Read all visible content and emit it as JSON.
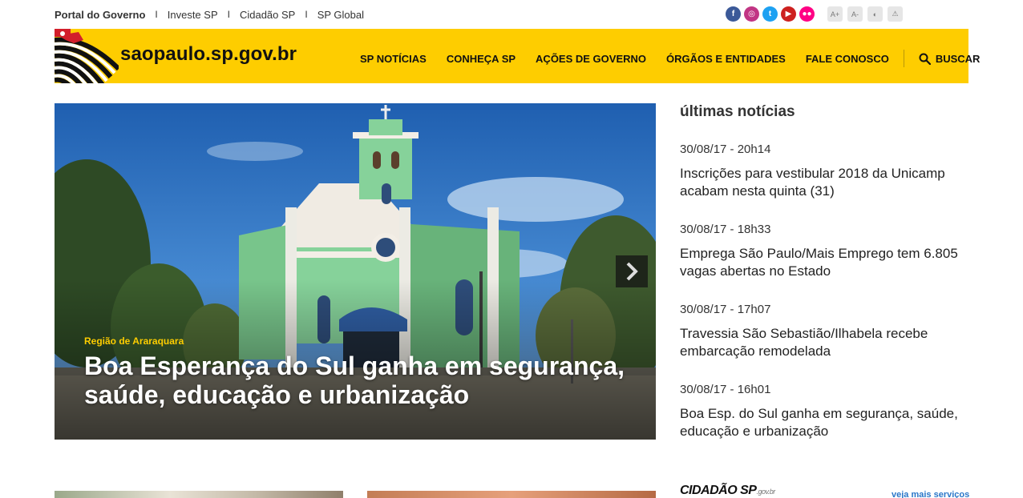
{
  "top_links": [
    "Portal do Governo",
    "Investe SP",
    "Cidadão SP",
    "SP Global"
  ],
  "top_separator": "I",
  "social": [
    {
      "name": "facebook-icon",
      "glyph": "f",
      "color": "#3b5998"
    },
    {
      "name": "instagram-icon",
      "glyph": "◎",
      "color": "#c13584"
    },
    {
      "name": "twitter-icon",
      "glyph": "t",
      "color": "#1da1f2"
    },
    {
      "name": "youtube-icon",
      "glyph": "▶",
      "color": "#cd201f"
    },
    {
      "name": "flickr-icon",
      "glyph": "●●",
      "color": "#ff0084"
    }
  ],
  "accessibility": [
    {
      "name": "font-increase-button",
      "glyph": "A+"
    },
    {
      "name": "font-decrease-button",
      "glyph": "A-"
    },
    {
      "name": "contrast-button",
      "glyph": "◐"
    },
    {
      "name": "warning-button",
      "glyph": "⚠"
    }
  ],
  "header": {
    "site_title": "saopaulo.sp.gov.br",
    "nav": [
      "SP NOTÍCIAS",
      "CONHEÇA SP",
      "AÇÕES DE GOVERNO",
      "ÓRGÃOS E ENTIDADES",
      "FALE CONOSCO"
    ],
    "search_label": "BUSCAR",
    "brand_color": "#fecd00"
  },
  "hero": {
    "kicker": "Região de Araraquara",
    "headline": "Boa Esperança do Sul ganha em segurança, saúde, educação e urbanização"
  },
  "news": {
    "title": "últimas notícias",
    "items": [
      {
        "date": "30/08/17 - 20h14",
        "headline": "Inscrições para vestibular 2018 da Unicamp acabam nesta quinta (31)"
      },
      {
        "date": "30/08/17 - 18h33",
        "headline": "Emprega São Paulo/Mais Emprego tem 6.805 vagas abertas no Estado"
      },
      {
        "date": "30/08/17 - 17h07",
        "headline": "Travessia São Sebastião/Ilhabela recebe embarcação remodelada"
      },
      {
        "date": "30/08/17 - 16h01",
        "headline": "Boa Esp. do Sul ganha em segurança, saúde, educação e urbanização"
      }
    ]
  },
  "bottom": {
    "cidadao_logo": "CIDADÃO SP",
    "cidadao_domain": ".gov.br",
    "more_services": "veja mais serviços"
  }
}
